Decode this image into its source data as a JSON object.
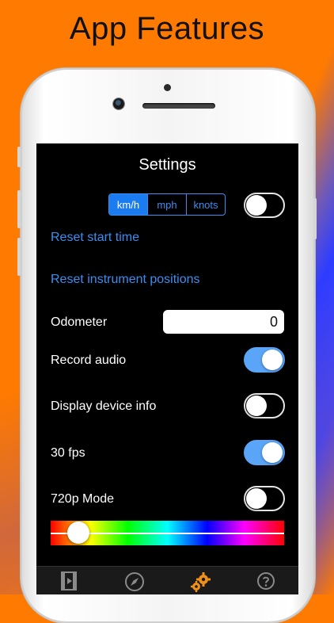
{
  "headline": "App Features",
  "settings": {
    "title": "Settings",
    "units": {
      "options": [
        "km/h",
        "mph",
        "knots"
      ],
      "selected": "km/h"
    },
    "units_toggle_on": false,
    "reset_start_time": "Reset start time",
    "reset_instrument_positions": "Reset instrument positions",
    "odometer": {
      "label": "Odometer",
      "value": "0"
    },
    "record_audio": {
      "label": "Record audio",
      "on": true
    },
    "display_device_info": {
      "label": "Display device info",
      "on": false
    },
    "fps30": {
      "label": "30 fps",
      "on": true
    },
    "mode720p": {
      "label": "720p Mode",
      "on": false
    },
    "color_slider_value": 0.12
  },
  "tabbar": {
    "items": [
      {
        "icon": "film-icon",
        "active": false
      },
      {
        "icon": "compass-icon",
        "active": false
      },
      {
        "icon": "gears-icon",
        "active": true
      },
      {
        "icon": "help-icon",
        "active": false
      }
    ]
  },
  "colors": {
    "accent": "#3b8ef0",
    "toggle_on": "#5aa5f7",
    "tab_active": "#f09018"
  }
}
